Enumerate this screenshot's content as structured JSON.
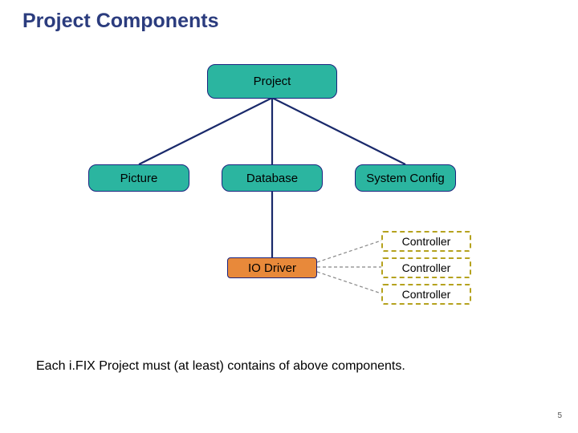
{
  "title": "Project Components",
  "nodes": {
    "project": "Project",
    "picture": "Picture",
    "database": "Database",
    "system_config": "System Config",
    "io_driver": "IO Driver",
    "controller1": "Controller",
    "controller2": "Controller",
    "controller3": "Controller"
  },
  "footnote": "Each i.FIX Project must (at least) contains of above components.",
  "page_number": "5",
  "chart_data": {
    "type": "diagram",
    "title": "Project Components",
    "nodes": [
      {
        "id": "project",
        "label": "Project",
        "fill": "#2bb5a0"
      },
      {
        "id": "picture",
        "label": "Picture",
        "fill": "#2bb5a0"
      },
      {
        "id": "database",
        "label": "Database",
        "fill": "#2bb5a0"
      },
      {
        "id": "system_config",
        "label": "System Config",
        "fill": "#2bb5a0"
      },
      {
        "id": "io_driver",
        "label": "IO Driver",
        "fill": "#e8893a"
      },
      {
        "id": "controller1",
        "label": "Controller",
        "style": "dashed"
      },
      {
        "id": "controller2",
        "label": "Controller",
        "style": "dashed"
      },
      {
        "id": "controller3",
        "label": "Controller",
        "style": "dashed"
      }
    ],
    "edges": [
      {
        "from": "project",
        "to": "picture",
        "style": "solid"
      },
      {
        "from": "project",
        "to": "database",
        "style": "solid"
      },
      {
        "from": "project",
        "to": "system_config",
        "style": "solid"
      },
      {
        "from": "database",
        "to": "io_driver",
        "style": "solid"
      },
      {
        "from": "io_driver",
        "to": "controller1",
        "style": "dashed"
      },
      {
        "from": "io_driver",
        "to": "controller2",
        "style": "dashed"
      },
      {
        "from": "io_driver",
        "to": "controller3",
        "style": "dashed"
      }
    ]
  }
}
